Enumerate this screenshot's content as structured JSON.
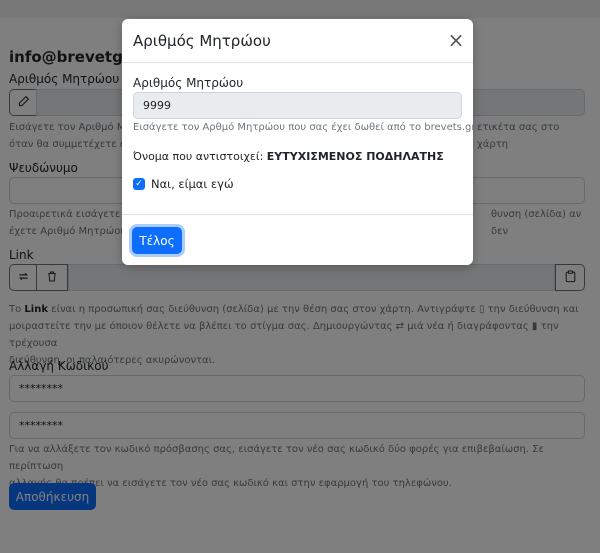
{
  "page": {
    "account_title": "info@brevetgps",
    "registry": {
      "label": "Αριθμός Μητρώου",
      "help_line1": "Εισάγετε τον Αριθμό Μη",
      "help_line1_right": "ετικέτα σας στο χάρτη",
      "help_line2": "όταν θα συμμετέχετε σε"
    },
    "nickname": {
      "label": "Ψευδώνυμο",
      "help_line1": "Προαιρετικά εισάγετε έν",
      "help_line1_right": "θυνση (σελίδα) αν δεν",
      "help_line2": "έχετε Αριθμό Μητρώου."
    },
    "link": {
      "label": "Link",
      "help_line1_a": "Το ",
      "help_line1_bold": "Link",
      "help_line1_b": " είναι η προσωπική σας διεύθυνση (σελίδα) με την θέση σας στον χάρτη. Αντιγράψτε ",
      "help_line1_c": " την διεύθυνση και",
      "help_line2_a": "μοιραστείτε την με όποιον θέλετε να βλέπει το στίγμα σας. Δημιουργώντας ",
      "help_line2_b": " μιά νέα ή διαγράφοντας ",
      "help_line2_c": " την τρέχουσα",
      "help_line3": "διεύθυνση, οι παλαιότερες ακυρώνονται."
    },
    "password": {
      "label": "Αλλαγή Κωδικού",
      "value1": "********",
      "value2": "********",
      "help_line1": "Για να αλλάξετε τον κωδικό πρόσβασης σας, εισάγετε τον νέο σας κωδικό δύο φορές για επιβεβαίωση. Σε περίπτωση",
      "help_line2": "αλλαγής θα πρέπει να εισάγετε τον νέο σας κωδικό και στην εφαρμογή του τηλεφώνου."
    },
    "save_label": "Αποθήκευση"
  },
  "modal": {
    "title": "Αριθμός Μητρώου",
    "close_symbol": "×",
    "field_label": "Αριθμός Μητρώου",
    "field_value": "9999",
    "field_help": "Εισάγετε τον Αρθμό Μητρώου που σας έχει δωθεί από το brevets.gr.",
    "name_prefix": "Όνομα που αντιστοιχεί: ",
    "name_value": "ΕΥΤΥΧΙΣΜΕΝΟΣ ΠΟΔΗΛΑΤΗΣ",
    "confirm_label": "Ναι, είμαι εγώ",
    "confirm_checked": true,
    "done_label": "Τέλος"
  },
  "colors": {
    "accent": "#0d6efd",
    "muted": "#6c757d",
    "disabled_bg": "#e9ecef",
    "backdrop": "rgba(0,0,0,0.5)"
  },
  "icons": [
    "pencil-icon",
    "refresh-icon",
    "trash-icon",
    "clipboard-icon",
    "close-icon",
    "check-icon"
  ]
}
